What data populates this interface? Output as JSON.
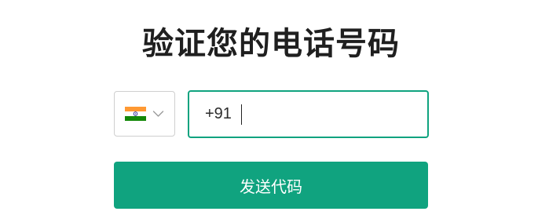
{
  "title": "验证您的电话号码",
  "country_selector": {
    "selected_flag": "flag-india-icon",
    "dial_code": "+91"
  },
  "phone_input": {
    "value": ""
  },
  "submit": {
    "label": "发送代码"
  },
  "colors": {
    "accent": "#10a37f",
    "text": "#1f1f1f",
    "border": "#cfcfcf"
  }
}
